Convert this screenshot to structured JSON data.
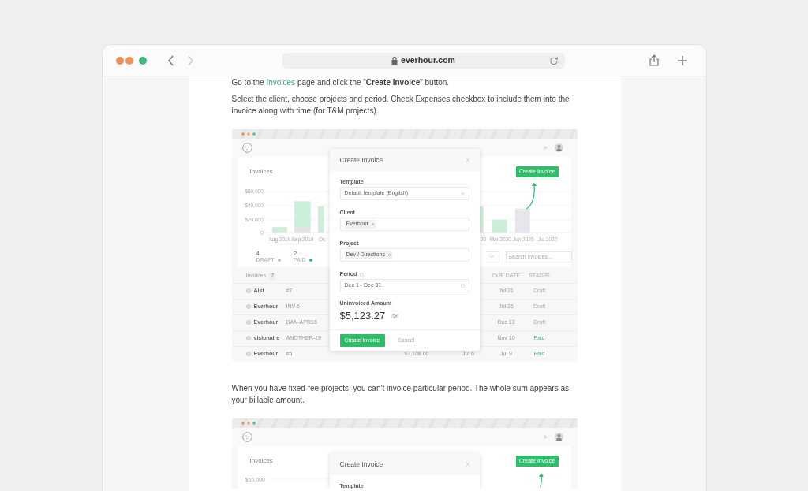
{
  "browser": {
    "nav": [
      {
        "kind": "back",
        "disabled": false
      },
      {
        "kind": "forward",
        "disabled": true
      }
    ],
    "address": "everhour.com"
  },
  "article": {
    "intro": {
      "parts": [
        {
          "text": "Go to the "
        },
        {
          "kind": "link",
          "text": "Invoices"
        },
        {
          "text": " page and click the \"**Create Invoice**\" button."
        }
      ]
    },
    "paragraph_1": "Select the client, choose projects and period. Check Expenses checkbox to include them into the invoice along with time (for T&M projects).",
    "screenshot_1": {
      "page_title": "Invoices",
      "create_button": "Create Invoice",
      "chart": {
        "y_labels": [
          "$60,000",
          "$40,000",
          "$20,000",
          "0"
        ],
        "left_x_labels": [
          "Aug 2019",
          "Sep 2019",
          "Oc"
        ],
        "right_x_labels": [
          "20",
          "Mar 2020",
          "Jun 2020",
          "Jul 2020"
        ]
      },
      "stats": [
        {
          "count": "4",
          "label": "DRAFT",
          "color": "#bdbdbd"
        },
        {
          "count": "2",
          "label": "PAID",
          "color": "#2dbe6c"
        }
      ],
      "search": {
        "placeholder": "Search invoices..."
      },
      "list": {
        "title": "Invoices",
        "count": "7",
        "columns": [
          "DUE DATE",
          "STATUS"
        ],
        "rows": [
          {
            "client": "Aist",
            "ref": "#7",
            "due": "Jul 21",
            "status": "Draft",
            "paid": false
          },
          {
            "client": "Everhour",
            "ref": "INV-6",
            "due": "Jul 26",
            "status": "Draft",
            "paid": false
          },
          {
            "client": "Everhour",
            "ref": "DAN-APR16",
            "due": "Dec 13",
            "status": "Draft",
            "paid": false
          },
          {
            "client": "visionaire",
            "ref": "ANOTHER-19",
            "due": "Nov 10",
            "status": "Paid",
            "paid": true
          },
          {
            "client": "Everhour",
            "ref": "#5",
            "amount": "$2,108.00",
            "issued": "Jul 6",
            "due": "Jul 9",
            "status": "Paid",
            "paid": true
          }
        ]
      },
      "modal": {
        "title": "Create Invoice",
        "fields": [
          {
            "kind": "select",
            "label": "Template",
            "value": "Default template (English)"
          },
          {
            "kind": "tags",
            "label": "Client",
            "tags": [
              "Everhour"
            ]
          },
          {
            "kind": "tags",
            "label": "Project",
            "tags": [
              "Dev / Directions"
            ]
          },
          {
            "kind": "date",
            "label": "Period",
            "info": true,
            "value": "Dec 1 - Dec 31"
          }
        ],
        "amount_label": "Uninvoiced Amount",
        "amount": "$5,123.27",
        "submit": "Create Invoice",
        "cancel": "Cancel"
      }
    },
    "paragraph_2": "When you have fixed-fee projects, you can't invoice particular period. The whole sum appears as your billable amount.",
    "screenshot_2": {
      "page_title": "Invoices",
      "create_button": "Create Invoice",
      "chart": {
        "y_labels": [
          "$60,000"
        ]
      },
      "modal": {
        "title": "Create Invoice",
        "fields": [
          {
            "label": "Template"
          }
        ]
      }
    }
  }
}
